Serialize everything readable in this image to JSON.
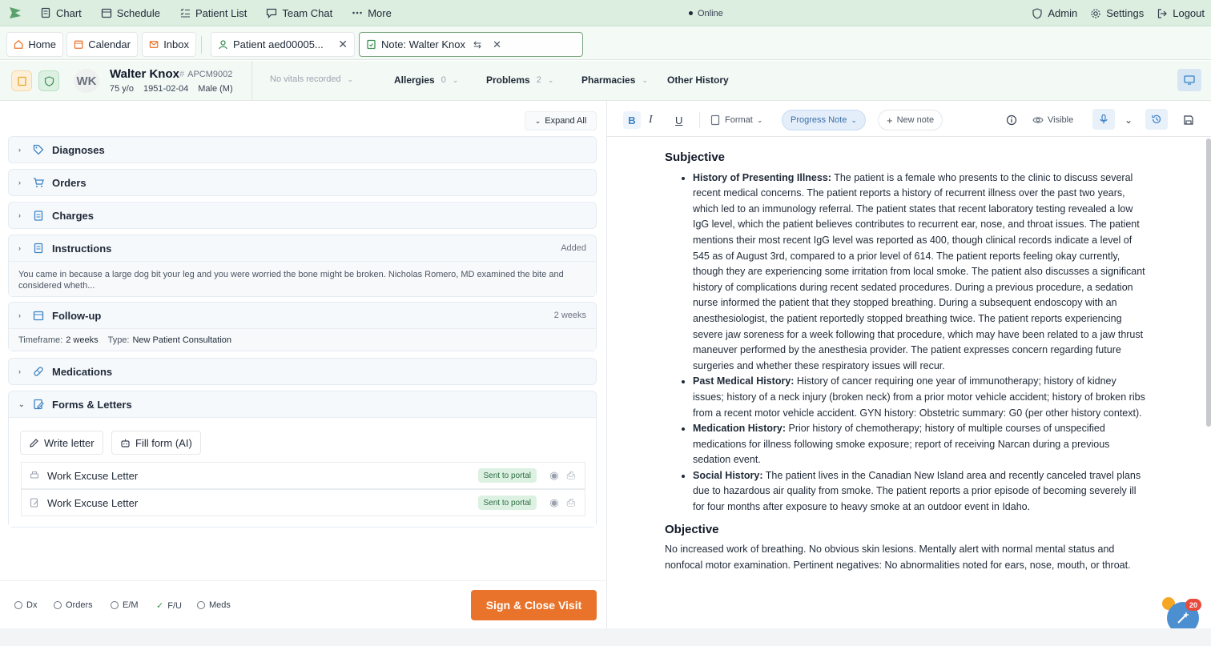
{
  "topnav": {
    "items": [
      {
        "label": "Chart",
        "icon": "document-icon"
      },
      {
        "label": "Schedule",
        "icon": "calendar-icon"
      },
      {
        "label": "Patient List",
        "icon": "list-icon"
      },
      {
        "label": "Team Chat",
        "icon": "chat-icon"
      },
      {
        "label": "More",
        "icon": "more-icon"
      }
    ],
    "status": "Online",
    "admin": "Admin",
    "settings": "Settings",
    "logout": "Logout"
  },
  "tabs": {
    "home": "Home",
    "calendar": "Calendar",
    "inbox": "Inbox",
    "patient": "Patient aed00005...",
    "note": "Note: Walter Knox"
  },
  "patient": {
    "initials": "WK",
    "name": "Walter Knox",
    "id": "APCM9002",
    "age": "75 y/o",
    "dob": "1951-02-04",
    "sex": "Male (M)",
    "vitals": "No vitals recorded",
    "allergies_label": "Allergies",
    "allergies_count": "0",
    "problems_label": "Problems",
    "problems_count": "2",
    "pharmacies_label": "Pharmacies",
    "other_history_label": "Other History"
  },
  "left": {
    "expand_all": "Expand All",
    "sections": {
      "diagnoses": "Diagnoses",
      "orders": "Orders",
      "charges": "Charges",
      "instructions": "Instructions",
      "instructions_status": "Added",
      "instructions_text": "You came in because a large dog bit your leg and you were worried the bone might be broken. Nicholas Romero, MD examined the bite and considered wheth...",
      "followup": "Follow-up",
      "followup_status": "2 weeks",
      "followup_timeframe_label": "Timeframe:",
      "followup_timeframe": "2 weeks",
      "followup_type_label": "Type:",
      "followup_type": "New Patient Consultation",
      "medications": "Medications",
      "forms": "Forms & Letters",
      "write_letter": "Write letter",
      "fill_form": "Fill form (AI)",
      "letters": [
        {
          "title": "Work Excuse Letter",
          "status": "Sent to portal"
        },
        {
          "title": "Work Excuse Letter",
          "status": "Sent to portal"
        }
      ]
    }
  },
  "bottom": {
    "checks": [
      "Dx",
      "Orders",
      "E/M",
      "F/U",
      "Meds"
    ],
    "sign_button": "Sign & Close Visit"
  },
  "editor": {
    "format": "Format",
    "note_type": "Progress Note",
    "new_note": "New note",
    "visible": "Visible",
    "subjective_heading": "Subjective",
    "hpi_label": "History of Presenting Illness:",
    "hpi_text": "The patient is a female who presents to the clinic to discuss several recent medical concerns. The patient reports a history of recurrent illness over the past two years, which led to an immunology referral. The patient states that recent laboratory testing revealed a low IgG level, which the patient believes contributes to recurrent ear, nose, and throat issues. The patient mentions their most recent IgG level was reported as 400, though clinical records indicate a level of 545 as of August 3rd, compared to a prior level of 614. The patient reports feeling okay currently, though they are experiencing some irritation from local smoke. The patient also discusses a significant history of complications during recent sedated procedures. During a previous procedure, a sedation nurse informed the patient that they stopped breathing. During a subsequent endoscopy with an anesthesiologist, the patient reportedly stopped breathing twice. The patient reports experiencing severe jaw soreness for a week following that procedure, which may have been related to a jaw thrust maneuver performed by the anesthesia provider. The patient expresses concern regarding future surgeries and whether these respiratory issues will recur.",
    "pmh_label": "Past Medical History:",
    "pmh_text": "History of cancer requiring one year of immunotherapy; history of kidney issues; history of a neck injury (broken neck) from a prior motor vehicle accident; history of broken ribs from a recent motor vehicle accident. GYN history: Obstetric summary: G0 (per other history context).",
    "med_label": "Medication History:",
    "med_text": "Prior history of chemotherapy; history of multiple courses of unspecified medications for illness following smoke exposure; report of receiving Narcan during a previous sedation event.",
    "social_label": "Social History:",
    "social_text": "The patient lives in the Canadian New Island area and recently canceled travel plans due to hazardous air quality from smoke. The patient reports a prior episode of becoming severely ill for four months after exposure to heavy smoke at an outdoor event in Idaho.",
    "objective_heading": "Objective",
    "objective_text": "No increased work of breathing. No obvious skin lesions. Mentally alert with normal mental status and nonfocal motor examination. Pertinent negatives: No abnormalities noted for ears, nose, mouth, or throat."
  },
  "fab_badge": "20",
  "colors": {
    "accent": "#e9732a",
    "nav_bg": "#dbeee0",
    "badge_bg": "#dcf1e2"
  }
}
